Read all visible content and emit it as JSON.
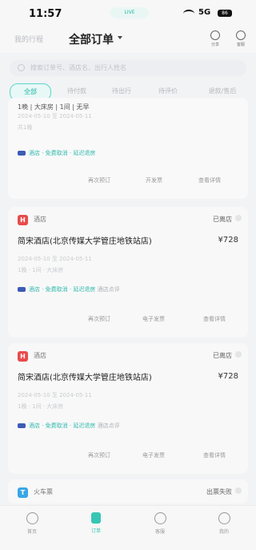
{
  "status_bar": {
    "time": "11:57",
    "center_pill": "LIVE",
    "network": "5G",
    "battery": "86"
  },
  "header": {
    "back": "我的行程",
    "title": "全部订单",
    "right_icons": [
      {
        "icon": "share-icon",
        "label": "分享"
      },
      {
        "icon": "help-icon",
        "label": "客服"
      }
    ]
  },
  "search": {
    "placeholder": "搜索订单号、酒店名、出行人姓名"
  },
  "tabs": [
    {
      "label": "全部",
      "active": true
    },
    {
      "label": "待付款"
    },
    {
      "label": "待出行"
    },
    {
      "label": "待评价"
    },
    {
      "label": "退款/售后"
    }
  ],
  "orders": [
    {
      "partial": true,
      "line1": "1晚 | 大床房 | 1间 | 无早",
      "date1": "2024-05-10 至 2024-05-11",
      "date2": "共1晚",
      "tag": "酒店 · 免费取消 · 延迟退房",
      "actions": [
        "再次预订",
        "开发票",
        "查看详情"
      ]
    },
    {
      "type": "酒店",
      "status": "已离店",
      "name": "简宋酒店(北京传媒大学管庄地铁站店)",
      "price": "¥728",
      "date1": "2024-05-10 至 2024-05-11",
      "date2": "1晚 · 1间 · 大床房",
      "tag": "酒店 · 免费取消 · 延迟退房",
      "tag_hint": "酒店点评",
      "actions": [
        "再次预订",
        "电子发票",
        "查看详情"
      ]
    },
    {
      "type": "酒店",
      "status": "已离店",
      "name": "简宋酒店(北京传媒大学管庄地铁站店)",
      "price": "¥728",
      "date1": "2024-05-10 至 2024-05-11",
      "date2": "1晚 · 1间 · 大床房",
      "tag": "酒店 · 免费取消 · 延迟退房",
      "tag_hint": "酒店点评",
      "actions": [
        "再次预订",
        "电子发票",
        "查看详情"
      ]
    },
    {
      "partial": true,
      "type": "火车票",
      "status": "出票失败"
    }
  ],
  "bottom_nav": [
    {
      "label": "首页",
      "icon": "home-icon"
    },
    {
      "label": "订单",
      "icon": "orders-icon",
      "active": true
    },
    {
      "label": "客服",
      "icon": "service-icon"
    },
    {
      "label": "我的",
      "icon": "profile-icon"
    }
  ]
}
